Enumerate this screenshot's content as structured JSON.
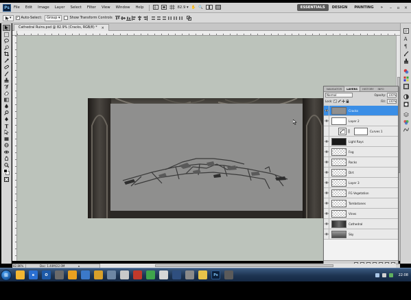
{
  "app": {
    "logo": "Ps"
  },
  "menu": [
    "File",
    "Edit",
    "Image",
    "Layer",
    "Select",
    "Filter",
    "View",
    "Window",
    "Help"
  ],
  "menu_controls": {
    "zoom": "82.9"
  },
  "workspaces": {
    "items": [
      "ESSENTIALS",
      "DESIGN",
      "PAINTING"
    ],
    "active": "ESSENTIALS",
    "more": "»"
  },
  "window_controls": {
    "minimize": "–",
    "restore": "▫",
    "close": "×"
  },
  "options_bar": {
    "auto_select_label": "Auto-Select:",
    "auto_select_checked": true,
    "auto_select_value": "Group",
    "transform_label": "Show Transform Controls",
    "transform_checked": false
  },
  "document_tab": {
    "title": "Cathedral Ruins.psd @ 82.9% (Cracks, RGB/8) *",
    "close": "×"
  },
  "layers_panel": {
    "tabs": [
      "NAVIGATOR",
      "LAYERS",
      "HISTORY",
      "INFO"
    ],
    "active_tab": "LAYERS",
    "blend_mode": "Normal",
    "opacity_label": "Opacity:",
    "opacity_value": "100%",
    "lock_label": "Lock:",
    "fill_label": "Fill:",
    "fill_value": "100%",
    "layers": [
      {
        "name": "Cracks",
        "visible": true,
        "selected": true,
        "thumb": "gray"
      },
      {
        "name": "Layer 2",
        "visible": true,
        "selected": false,
        "thumb": "layer2"
      },
      {
        "name": "Curves 1",
        "visible": false,
        "selected": false,
        "thumb": "adjustment"
      },
      {
        "name": "Light Rays",
        "visible": true,
        "selected": false,
        "thumb": "dark"
      },
      {
        "name": "Fog",
        "visible": true,
        "selected": false,
        "thumb": "transparent"
      },
      {
        "name": "Rocks",
        "visible": true,
        "selected": false,
        "thumb": "transparent"
      },
      {
        "name": "Dirt",
        "visible": true,
        "selected": false,
        "thumb": "transparent"
      },
      {
        "name": "Layer 3",
        "visible": true,
        "selected": false,
        "thumb": "transparent"
      },
      {
        "name": "FG Vegetation",
        "visible": true,
        "selected": false,
        "thumb": "transparent"
      },
      {
        "name": "Tombstones",
        "visible": true,
        "selected": false,
        "thumb": "transparent"
      },
      {
        "name": "Vines",
        "visible": true,
        "selected": false,
        "thumb": "transparent"
      },
      {
        "name": "Cathedral",
        "visible": true,
        "selected": false,
        "thumb": "cathedral"
      },
      {
        "name": "Sky",
        "visible": true,
        "selected": false,
        "thumb": "sky"
      }
    ]
  },
  "status_bar": {
    "zoom": "82.86%",
    "doc_info": "Doc: 1.40M/22.0M",
    "arrow": "▸"
  },
  "taskbar": {
    "clock": "22:08"
  },
  "colors": {
    "canvas_bg": "#bcc3bb",
    "selected_layer": "#3a8ee6",
    "taskbar": "#1d3452"
  }
}
